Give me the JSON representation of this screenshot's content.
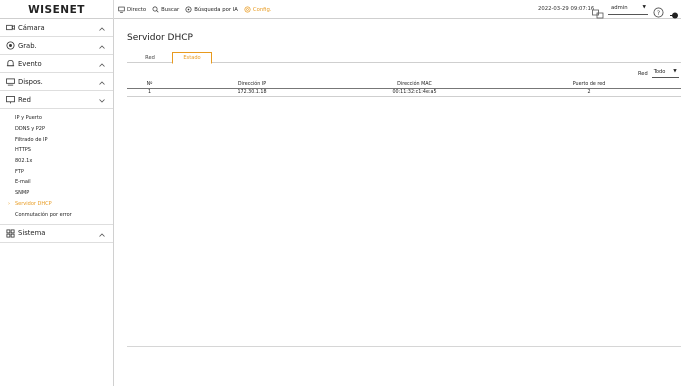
{
  "header": {
    "logo": "WISENET",
    "nav": [
      {
        "label": "Directo",
        "icon": "monitor-icon"
      },
      {
        "label": "Buscar",
        "icon": "search-icon"
      },
      {
        "label": "Búsqueda por IA",
        "icon": "ai-search-icon"
      },
      {
        "label": "Config.",
        "icon": "gear-icon"
      }
    ],
    "datetime": "2022-03-29 09:07:16",
    "user": "admin"
  },
  "sidebar": {
    "sections": [
      {
        "label": "Cámara",
        "icon": "camera-icon",
        "expanded": false
      },
      {
        "label": "Grab.",
        "icon": "record-icon",
        "expanded": false
      },
      {
        "label": "Evento",
        "icon": "bell-icon",
        "expanded": false
      },
      {
        "label": "Dispos.",
        "icon": "device-icon",
        "expanded": false
      },
      {
        "label": "Red",
        "icon": "network-icon",
        "expanded": true
      },
      {
        "label": "Sistema",
        "icon": "system-icon",
        "expanded": false
      }
    ],
    "red_items": [
      {
        "label": "IP y Puerto",
        "active": false
      },
      {
        "label": "DDNS y P2P",
        "active": false
      },
      {
        "label": "Filtrado de IP",
        "active": false
      },
      {
        "label": "HTTPS",
        "active": false
      },
      {
        "label": "802.1x",
        "active": false
      },
      {
        "label": "FTP",
        "active": false
      },
      {
        "label": "E-mail",
        "active": false
      },
      {
        "label": "SNMP",
        "active": false
      },
      {
        "label": "Servidor DHCP",
        "active": true
      },
      {
        "label": "Conmutación por error",
        "active": false
      }
    ]
  },
  "main": {
    "title": "Servidor DHCP",
    "tabs": [
      {
        "label": "Red",
        "active": false
      },
      {
        "label": "Estado",
        "active": true
      }
    ],
    "filter": {
      "label": "Red",
      "value": "Todo"
    },
    "table": {
      "columns": [
        "Nº",
        "Dirección IP",
        "Dirección MAC",
        "Puerto de red"
      ],
      "rows": [
        [
          "1",
          "172.30.1.18",
          "00:11:32:c1:4e:a5",
          "2"
        ]
      ]
    }
  },
  "colors": {
    "accent": "#e89a1e",
    "text": "#222222",
    "border": "#cfcfcf"
  }
}
